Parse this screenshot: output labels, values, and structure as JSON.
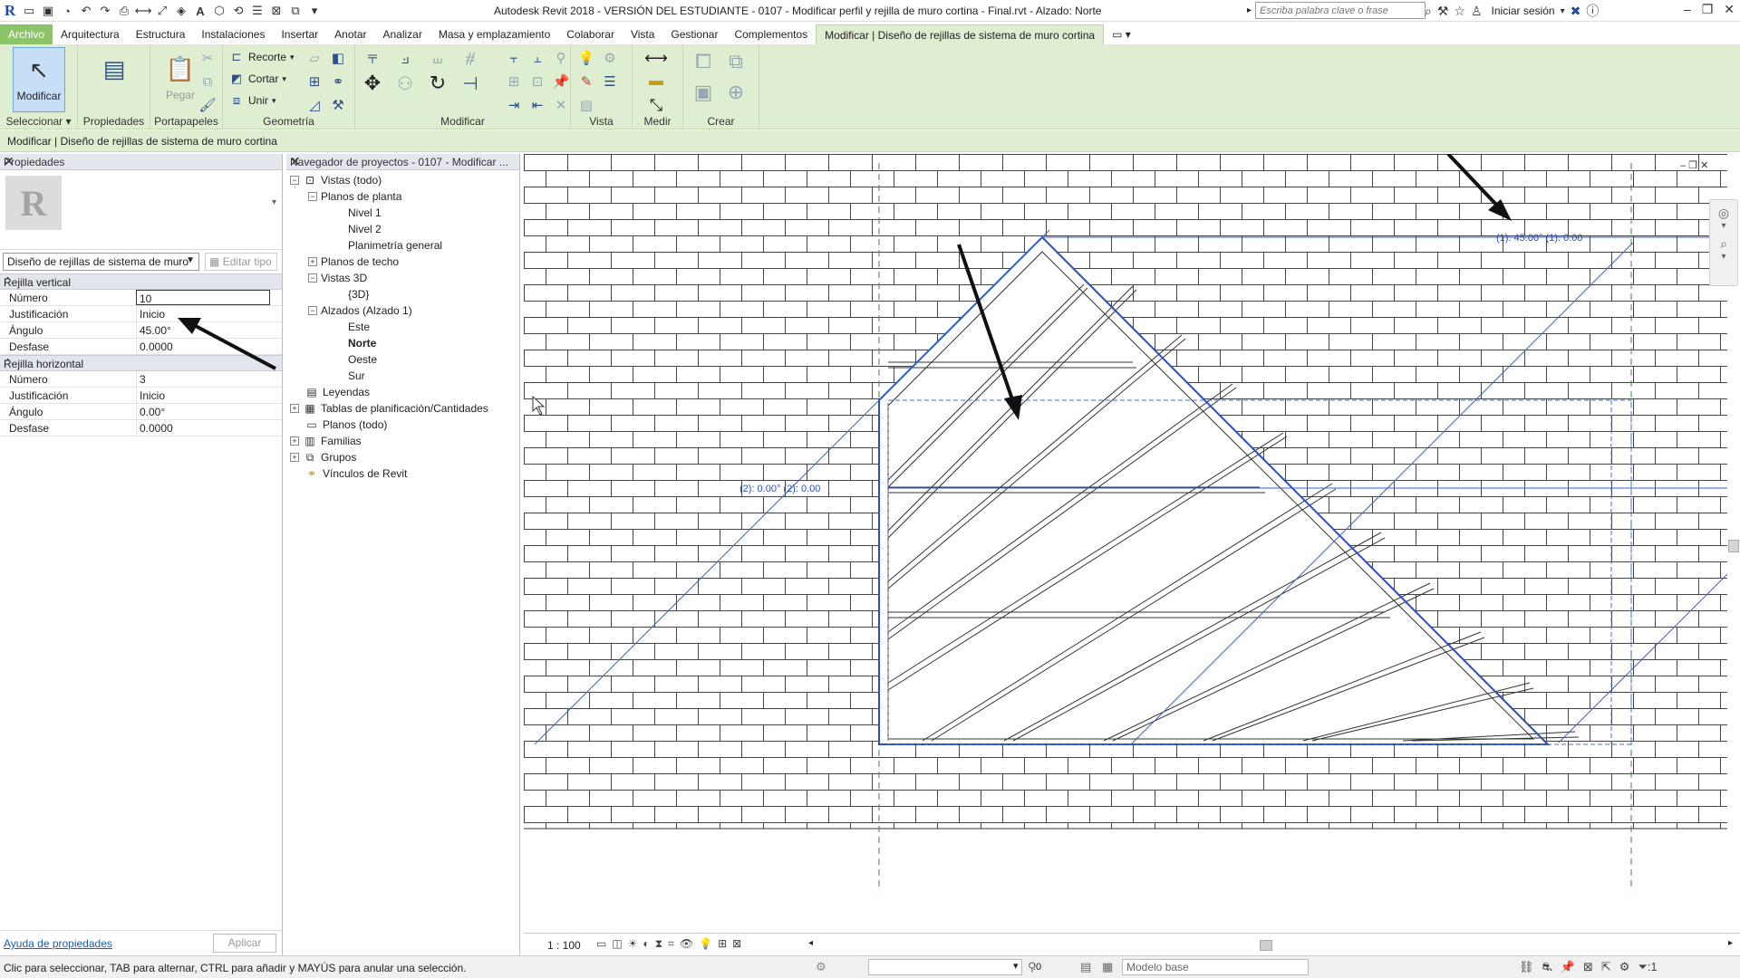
{
  "window": {
    "title": "Autodesk Revit 2018 -  VERSIÓN DEL ESTUDIANTE -     0107 - Modificar perfil y rejilla de muro cortina - Final.rvt - Alzado: Norte",
    "search_placeholder": "Escriba palabra clave o frase",
    "signin": "Iniciar sesión"
  },
  "tabs": [
    "Archivo",
    "Arquitectura",
    "Estructura",
    "Instalaciones",
    "Insertar",
    "Anotar",
    "Analizar",
    "Masa y emplazamiento",
    "Colaborar",
    "Vista",
    "Gestionar",
    "Complementos",
    "Modificar | Diseño de rejillas de sistema de muro cortina"
  ],
  "ribbon": {
    "modificar": "Modificar",
    "seleccionar": "Seleccionar ▾",
    "propiedades": "Propiedades",
    "pegar": "Pegar",
    "portapapeles": "Portapapeles",
    "recorte": "Recorte",
    "cortar": "Cortar",
    "unir": "Unir",
    "geometria": "Geometría",
    "panel_modificar": "Modificar",
    "vista": "Vista",
    "medir": "Medir",
    "crear": "Crear"
  },
  "context_bar": "Modificar | Diseño de rejillas de sistema de muro cortina",
  "properties": {
    "header": "Propiedades",
    "type_name": "Diseño de rejillas de sistema de muro",
    "edit_type": "Editar tipo",
    "vertical_group": "Rejilla vertical",
    "vertical": [
      {
        "name": "Número",
        "value": "10"
      },
      {
        "name": "Justificación",
        "value": "Inicio"
      },
      {
        "name": "Ángulo",
        "value": "45.00°"
      },
      {
        "name": "Desfase",
        "value": "0.0000"
      }
    ],
    "horizontal_group": "Rejilla horizontal",
    "horizontal": [
      {
        "name": "Número",
        "value": "3"
      },
      {
        "name": "Justificación",
        "value": "Inicio"
      },
      {
        "name": "Ángulo",
        "value": "0.00°"
      },
      {
        "name": "Desfase",
        "value": "0.0000"
      }
    ],
    "help": "Ayuda de propiedades",
    "apply": "Aplicar"
  },
  "browser": {
    "header": "Navegador de proyectos - 0107 - Modificar ...",
    "nodes": {
      "vistas": "Vistas (todo)",
      "planos_planta": "Planos de planta",
      "nivel1": "Nivel 1",
      "nivel2": "Nivel 2",
      "planimetria": "Planimetría general",
      "planos_techo": "Planos de techo",
      "vistas3d": "Vistas 3D",
      "v3d": "{3D}",
      "alzados": "Alzados (Alzado 1)",
      "este": "Este",
      "norte": "Norte",
      "oeste": "Oeste",
      "sur": "Sur",
      "leyendas": "Leyendas",
      "tablas": "Tablas de planificación/Cantidades",
      "planos": "Planos (todo)",
      "familias": "Familias",
      "grupos": "Grupos",
      "vinculos": "Vínculos de Revit"
    }
  },
  "canvas": {
    "label_top": "(1): 45.00°   (1): 0.00",
    "label_mid": "(2): 0.00°   (2): 0.00"
  },
  "view_controls": {
    "scale": "1 : 100"
  },
  "status": {
    "message": "Clic para seleccionar, TAB para alternar, CTRL para añadir y MAYÚS para anular una selección.",
    "zero": ":0",
    "model": "Modelo base"
  },
  "colors": {
    "ribbon": "#dfeed1",
    "selection": "#2a4fbf",
    "ref_line": "#3c8c3c"
  }
}
